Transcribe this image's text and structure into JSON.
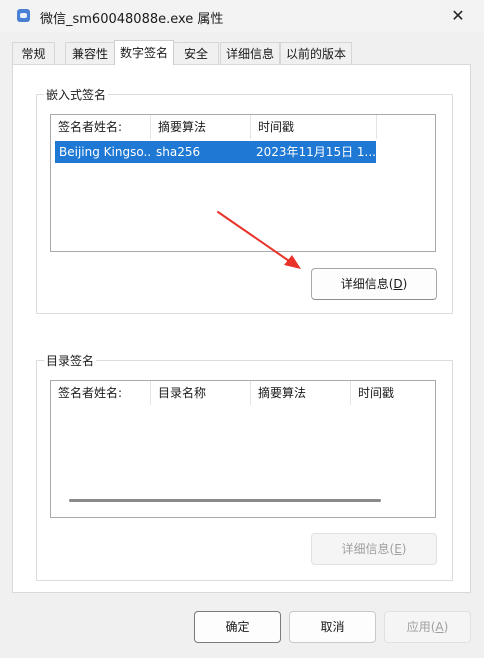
{
  "window": {
    "title": "微信_sm60048088e.exe 属性",
    "close_glyph": "✕",
    "icon": "app-icon"
  },
  "tabs": [
    {
      "label": "常规"
    },
    {
      "label": "兼容性"
    },
    {
      "label": "数字签名"
    },
    {
      "label": "安全"
    },
    {
      "label": "详细信息"
    },
    {
      "label": "以前的版本"
    }
  ],
  "active_tab": "数字签名",
  "embedded": {
    "group_label": "嵌入式签名",
    "columns": [
      "签名者姓名:",
      "摘要算法",
      "时间戳"
    ],
    "rows": [
      {
        "signer": "Beijing Kingso...",
        "digest": "sha256",
        "timestamp": "2023年11月15日 1..."
      }
    ],
    "details_button": {
      "label": "详细信息(",
      "mnemonic": "D",
      "suffix": ")"
    }
  },
  "catalog": {
    "group_label": "目录签名",
    "columns": [
      "签名者姓名:",
      "目录名称",
      "摘要算法",
      "时间戳"
    ],
    "details_button": {
      "label": "详细信息(",
      "mnemonic": "E",
      "suffix": ")"
    }
  },
  "footer": {
    "ok": "确定",
    "cancel": "取消",
    "apply": {
      "label": "应用(",
      "mnemonic": "A",
      "suffix": ")"
    }
  },
  "colors": {
    "selection": "#1e78d4",
    "annotation_arrow": "#e8322a"
  }
}
